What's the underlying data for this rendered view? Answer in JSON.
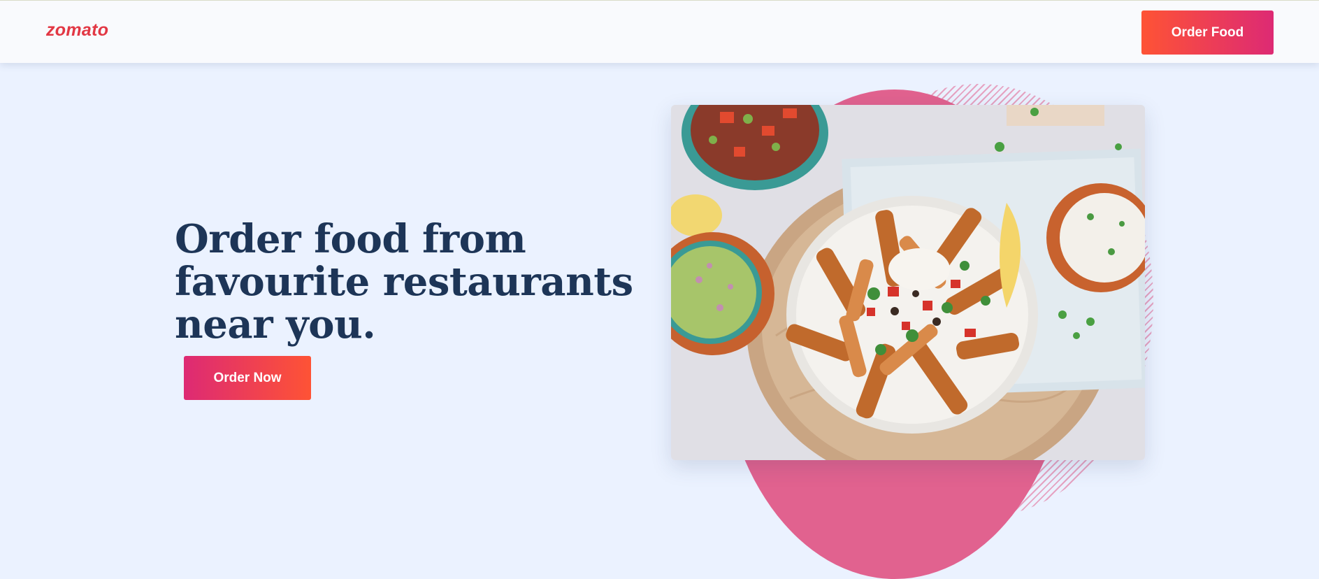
{
  "brand": {
    "logo_text": "zomato",
    "color": "#e23744"
  },
  "navbar": {
    "order_food_label": "Order Food"
  },
  "hero": {
    "title_lines": [
      "Order food from",
      "favourite restaurants",
      "near you."
    ],
    "cta_label": "Order Now",
    "title_color": "#1d3557"
  },
  "image": {
    "subject": "food-platter-photo"
  },
  "colors": {
    "background": "#ebf2ff",
    "gradient_start": "#fe5335",
    "gradient_end": "#dd2a74",
    "accent_pink": "#e1628f"
  }
}
